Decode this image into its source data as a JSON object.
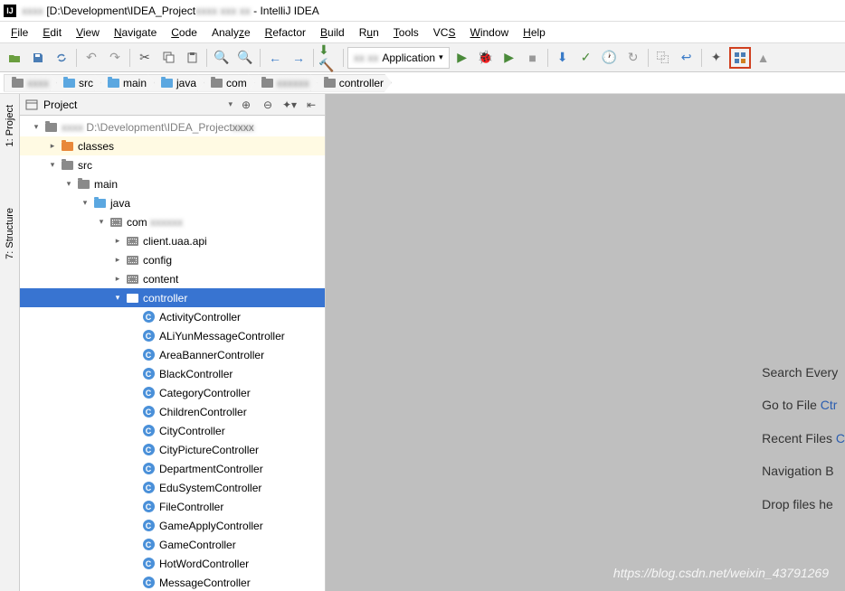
{
  "title": {
    "prefix_blur": "xxxx",
    "path": "[D:\\Development\\IDEA_Project",
    "mid_blur": "xxxx xxx xx",
    "suffix": "- IntelliJ IDEA"
  },
  "menu": [
    "File",
    "Edit",
    "View",
    "Navigate",
    "Code",
    "Analyze",
    "Refactor",
    "Build",
    "Run",
    "Tools",
    "VCS",
    "Window",
    "Help"
  ],
  "run_config": "Application",
  "breadcrumbs": [
    {
      "label": "",
      "blur": true,
      "icon": "folder-gray"
    },
    {
      "label": "src",
      "icon": "folder-blue"
    },
    {
      "label": "main",
      "icon": "folder-blue"
    },
    {
      "label": "java",
      "icon": "folder-blue"
    },
    {
      "label": "com",
      "icon": "folder-gray"
    },
    {
      "label": "",
      "blur": true,
      "icon": "folder-gray"
    },
    {
      "label": "controller",
      "icon": "folder-gray"
    }
  ],
  "gutter": {
    "project": "1: Project",
    "structure": "7: Structure"
  },
  "panel": {
    "title": "Project"
  },
  "tree": [
    {
      "d": 0,
      "arrow": "down",
      "icon": "folder-gray",
      "label": "",
      "blur": true,
      "suffix": "D:\\Development\\IDEA_Project",
      "suffix_blur": "xxxx",
      "hl": false
    },
    {
      "d": 1,
      "arrow": "right",
      "icon": "folder-orange",
      "label": "classes",
      "hl": true
    },
    {
      "d": 1,
      "arrow": "down",
      "icon": "folder-gray",
      "label": "src"
    },
    {
      "d": 2,
      "arrow": "down",
      "icon": "folder-gray",
      "label": "main"
    },
    {
      "d": 3,
      "arrow": "down",
      "icon": "folder-blue",
      "label": "java"
    },
    {
      "d": 4,
      "arrow": "down",
      "icon": "pkg",
      "label": "com",
      "label_blur": "xxxxxx"
    },
    {
      "d": 5,
      "arrow": "right",
      "icon": "pkg",
      "label": "client.uaa.api"
    },
    {
      "d": 5,
      "arrow": "right",
      "icon": "pkg",
      "label": "config"
    },
    {
      "d": 5,
      "arrow": "right",
      "icon": "pkg",
      "label": "content"
    },
    {
      "d": 5,
      "arrow": "down",
      "icon": "pkg",
      "label": "controller",
      "sel": true
    },
    {
      "d": 6,
      "icon": "class",
      "label": "ActivityController"
    },
    {
      "d": 6,
      "icon": "class",
      "label": "ALiYunMessageController"
    },
    {
      "d": 6,
      "icon": "class",
      "label": "AreaBannerController"
    },
    {
      "d": 6,
      "icon": "class",
      "label": "BlackController"
    },
    {
      "d": 6,
      "icon": "class",
      "label": "CategoryController"
    },
    {
      "d": 6,
      "icon": "class",
      "label": "ChildrenController"
    },
    {
      "d": 6,
      "icon": "class",
      "label": "CityController"
    },
    {
      "d": 6,
      "icon": "class",
      "label": "CityPictureController"
    },
    {
      "d": 6,
      "icon": "class",
      "label": "DepartmentController"
    },
    {
      "d": 6,
      "icon": "class",
      "label": "EduSystemController"
    },
    {
      "d": 6,
      "icon": "class",
      "label": "FileController"
    },
    {
      "d": 6,
      "icon": "class",
      "label": "GameApplyController"
    },
    {
      "d": 6,
      "icon": "class",
      "label": "GameController"
    },
    {
      "d": 6,
      "icon": "class",
      "label": "HotWordController"
    },
    {
      "d": 6,
      "icon": "class",
      "label": "MessageController"
    }
  ],
  "hints": {
    "search": "Search Every",
    "goto": "Go to File ",
    "goto_link": "Ctr",
    "recent": "Recent Files ",
    "recent_link": "C",
    "nav": "Navigation B",
    "drop": "Drop files he"
  },
  "watermark": "https://blog.csdn.net/weixin_43791269"
}
